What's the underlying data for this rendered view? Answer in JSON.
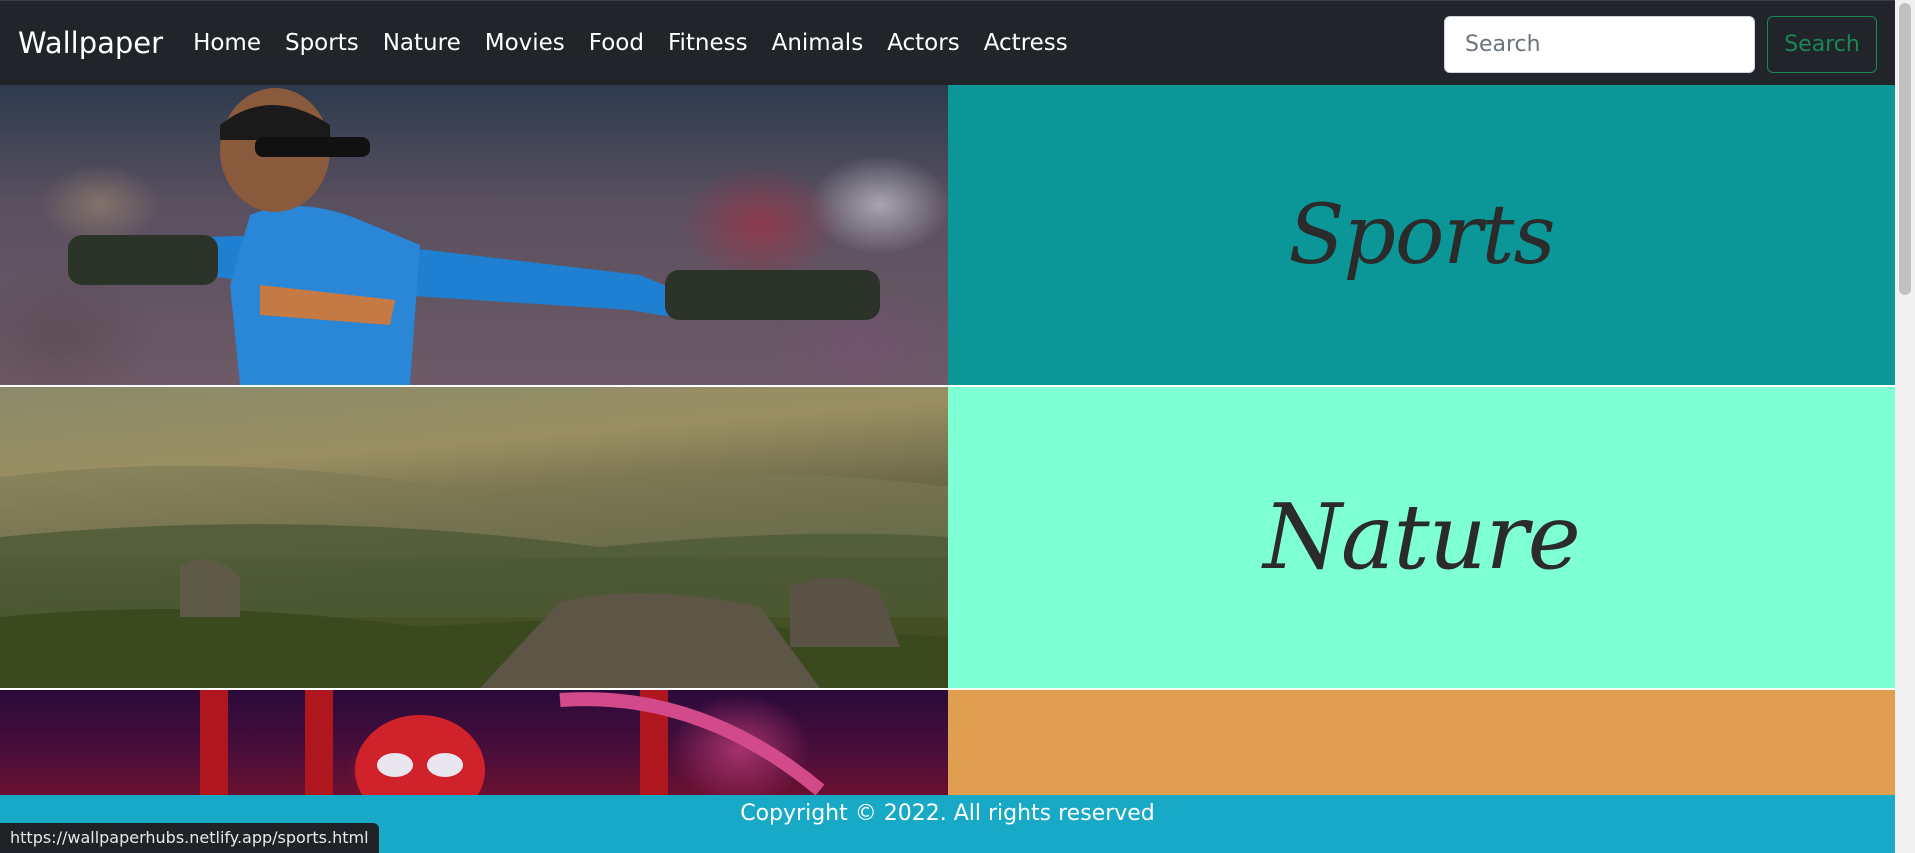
{
  "navbar": {
    "brand": "Wallpaper",
    "links": [
      "Home",
      "Sports",
      "Nature",
      "Movies",
      "Food",
      "Fitness",
      "Animals",
      "Actors",
      "Actress"
    ],
    "search": {
      "placeholder": "Search",
      "button_label": "Search"
    }
  },
  "categories": [
    {
      "title": "Sports",
      "color": "#0b9697"
    },
    {
      "title": "Nature",
      "color": "#7fffd4"
    },
    {
      "title": "",
      "color": "#e09f50"
    }
  ],
  "footer": {
    "text": "Copyright © 2022. All rights reserved"
  },
  "status_bar": {
    "url": "https://wallpaperhubs.netlify.app/sports.html"
  },
  "colors": {
    "navbar_bg": "#212529",
    "footer_bg": "#17a9c5",
    "search_button": "#198754"
  }
}
